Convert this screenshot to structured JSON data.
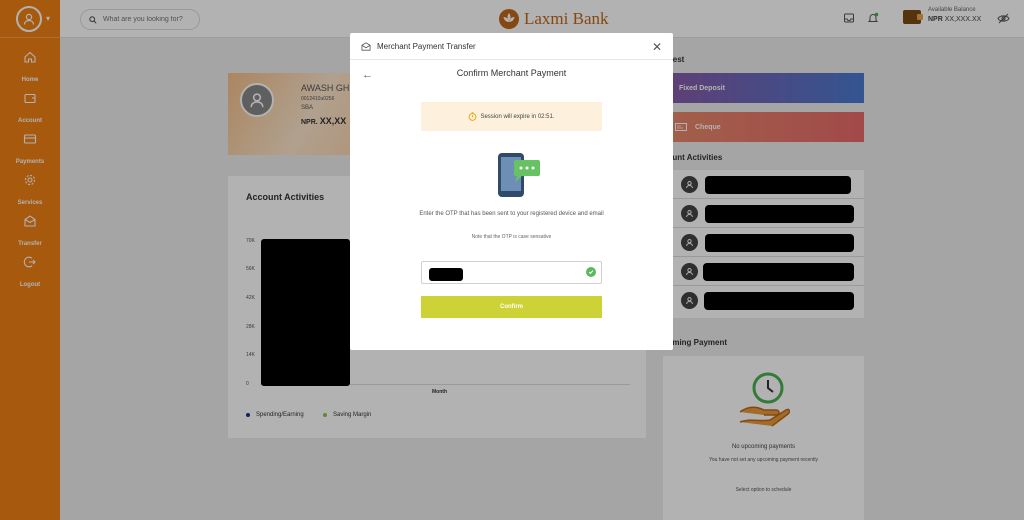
{
  "colors": {
    "brand_orange": "#ef8115",
    "confirm_green": "#cdd236",
    "session_bg": "#fdf0dc",
    "spending_dot": "#1f2f8a",
    "saving_dot": "#8bc34a"
  },
  "sidebar": {
    "items": [
      {
        "label": "Home",
        "icon": "home-icon"
      },
      {
        "label": "Account",
        "icon": "wallet-icon"
      },
      {
        "label": "Payments",
        "icon": "card-icon"
      },
      {
        "label": "Services",
        "icon": "gear-icon"
      },
      {
        "label": "Transfer",
        "icon": "transfer-icon"
      },
      {
        "label": "Logout",
        "icon": "logout-icon"
      }
    ]
  },
  "header": {
    "search_placeholder": "What are you looking for?",
    "brand": "Laxmi Bank",
    "balance_label": "Available Balance",
    "balance_currency": "NPR",
    "balance_value": "XX,XXX.XX"
  },
  "profile": {
    "name": "AWASH GH",
    "account_number": "0012410u0256",
    "account_type": "SBA",
    "currency": "NPR.",
    "balance": "XX,XX"
  },
  "activity": {
    "title": "Account Activities",
    "y_ticks": [
      "70K",
      "56K",
      "42K",
      "28K",
      "14K",
      "0"
    ],
    "x_label": "Month",
    "legend": [
      {
        "label": "Spending/Earning"
      },
      {
        "label": "Saving Margin"
      }
    ]
  },
  "right": {
    "request_title": "quest",
    "fixed_deposit": "Fixed Deposit",
    "cheque": "Cheque",
    "activities_title": "count Activities",
    "upcoming_title": "coming Payment",
    "no_upcoming": "No upcoming payments",
    "no_upcoming_sub": "You have not set any upcoming payment recently",
    "select_option": "Select option to schedule"
  },
  "modal": {
    "header_title": "Merchant Payment Transfer",
    "title": "Confirm Merchant Payment",
    "session_text": "Session will expire in 02:51.",
    "desc": "Enter the OTP that has been sent to your registered device and email",
    "note": "Note that the OTP is case sensative",
    "confirm_label": "Confirm"
  }
}
